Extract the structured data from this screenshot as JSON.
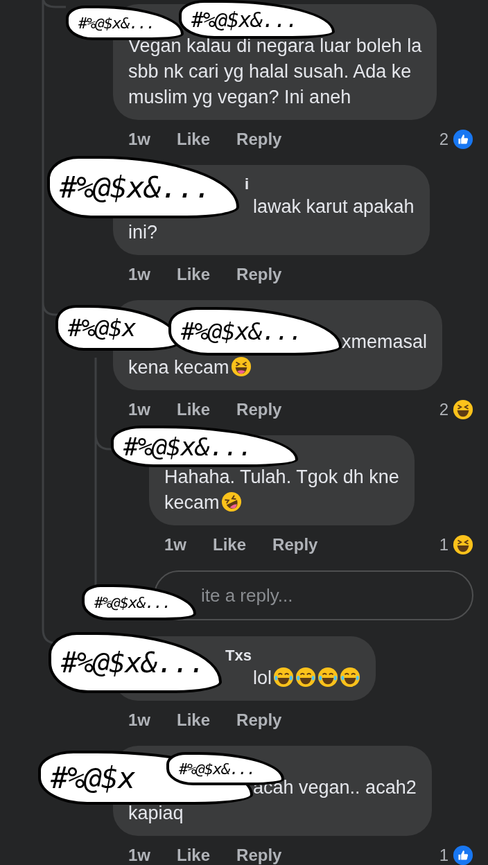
{
  "comments": [
    {
      "lines": [
        "Vegan kalau di negara luar boleh la",
        "sbb nk cari yg halal susah. Ada ke",
        "muslim yg vegan? Ini aneh"
      ],
      "time": "1w",
      "like": "Like",
      "reply": "Reply",
      "reaction": {
        "count": "2",
        "kind": "like"
      }
    },
    {
      "name": "i",
      "lines": [
        "lawak karut apakah",
        "ini?"
      ],
      "time": "1w",
      "like": "Like",
      "reply": "Reply"
    },
    {
      "lines": [
        "xmemasal",
        "kena kecam"
      ],
      "emojis": [
        {
          "kind": "squint"
        }
      ],
      "time": "1w",
      "like": "Like",
      "reply": "Reply",
      "reaction": {
        "count": "2",
        "kind": "haha"
      },
      "children": [
        {
          "lines": [
            "Hahaha. Tulah. Tgok dh kne",
            "kecam"
          ],
          "emojis": [
            {
              "kind": "rofl"
            }
          ],
          "time": "1w",
          "like": "Like",
          "reply": "Reply",
          "reaction": {
            "count": "1",
            "kind": "haha"
          }
        }
      ],
      "reply_field": {
        "placeholder": "ite a reply..."
      }
    },
    {
      "name": "Txs",
      "lines": [
        "lol"
      ],
      "emojis": [
        {
          "kind": "joy"
        },
        {
          "kind": "joy"
        },
        {
          "kind": "joy"
        },
        {
          "kind": "joy"
        }
      ],
      "time": "1w",
      "like": "Like",
      "reply": "Reply"
    },
    {
      "lines": [
        "acah vegan.. acah2",
        "kapiaq"
      ],
      "time": "1w",
      "like": "Like",
      "reply": "Reply",
      "reaction": {
        "count": "1",
        "kind": "like"
      }
    }
  ],
  "stickers": [
    {
      "text": "#%@$x&..."
    },
    {
      "text": "#%@$x&..."
    },
    {
      "text": "#%@$x&..."
    },
    {
      "text": "#%@$x"
    },
    {
      "text": "#%@$x&..."
    },
    {
      "text": "#%@$x&..."
    },
    {
      "text": "#%@$x&..."
    },
    {
      "text": "#%@$x&..."
    },
    {
      "text": "#%@$x"
    },
    {
      "text": "#%@$x&..."
    }
  ]
}
